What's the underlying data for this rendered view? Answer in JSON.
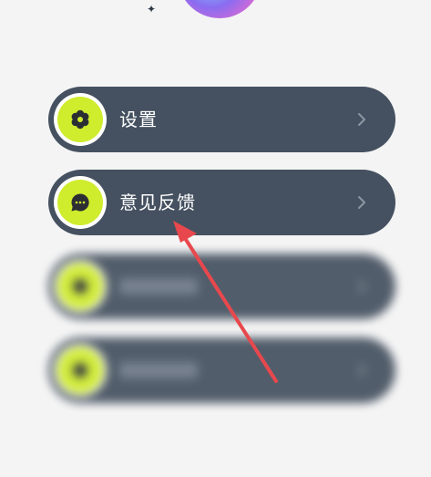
{
  "header": {
    "avatar_icon": "avatar-icon",
    "sparkle_icon": "sparkle-icon"
  },
  "menu": {
    "items": [
      {
        "label": "设置",
        "icon": "gear-icon"
      },
      {
        "label": "意见反馈",
        "icon": "chat-bubble-icon"
      },
      {
        "label": "",
        "icon": "blurred-icon"
      },
      {
        "label": "",
        "icon": "blurred-icon"
      }
    ]
  },
  "colors": {
    "background": "#f4f4f4",
    "item_background": "#455160",
    "accent": "#cfec2d",
    "annotation_arrow": "#e8484d"
  }
}
